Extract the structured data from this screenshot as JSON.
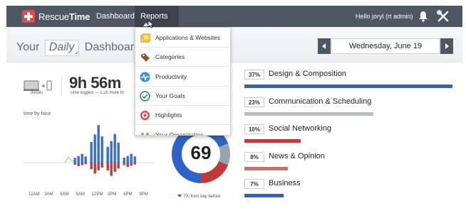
{
  "topbar": {
    "brand_light": "Rescue",
    "brand_bold": "Time",
    "nav_dashboard": "Dashboard",
    "nav_reports": "Reports",
    "greeting": "Hello joryl (rt admin)"
  },
  "header": {
    "title_prefix": "Your",
    "period": "Daily",
    "title_suffix": "Dashboard",
    "date": "Wednesday, June 19"
  },
  "summary": {
    "details_label": "details",
    "time_logged": "9h 56m",
    "time_logged_sub": "Time logged — 1.2h more th"
  },
  "hour_chart": {
    "label": "time by hour",
    "ticks": [
      "12AM",
      "3AM",
      "6AM",
      "9AM",
      "12PM",
      "3PM",
      "6PM",
      "9PM"
    ]
  },
  "chart_data": {
    "type": "bar",
    "title": "time by hour",
    "categories": [
      "12AM",
      "3AM",
      "6AM",
      "9AM",
      "12PM",
      "3PM",
      "6PM",
      "9PM"
    ],
    "series": [
      {
        "values": [
          0,
          0,
          0,
          20,
          85,
          65,
          20,
          0
        ],
        "color": "#3a6fc8"
      },
      {
        "values": [
          0,
          0,
          0,
          8,
          25,
          30,
          10,
          0
        ],
        "color": "#c0393b"
      }
    ]
  },
  "pulse": {
    "score": "69",
    "score_value": 69,
    "delta_text": "7% from day before",
    "colors": {
      "productive": "#2e63c6",
      "neutral": "#9aa3ad",
      "distracting": "#c0393b"
    }
  },
  "categories": [
    {
      "pct": "37%",
      "name": "Design & Composition",
      "fraction": 1.0,
      "color": "#2e63c6"
    },
    {
      "pct": "23%",
      "name": "Communication & Scheduling",
      "fraction": 0.62,
      "color": "#b9bcc0"
    },
    {
      "pct": "10%",
      "name": "Social Networking",
      "fraction": 0.27,
      "color": "#c0393b"
    },
    {
      "pct": "8%",
      "name": "News & Opinion",
      "fraction": 0.21,
      "color": "#d46a6a"
    },
    {
      "pct": "7%",
      "name": "Business",
      "fraction": 0.19,
      "color": "#2e63c6"
    }
  ],
  "reports_menu": {
    "items": [
      {
        "label": "Applications & Websites",
        "icon": "applications-icon"
      },
      {
        "label": "Categories",
        "icon": "tag-icon"
      },
      {
        "label": "Productivity",
        "icon": "pulse-icon"
      },
      {
        "label": "Your Goals",
        "icon": "check-circle-icon"
      },
      {
        "label": "Highlights",
        "icon": "highlights-icon"
      },
      {
        "label": "Your Organization",
        "icon": "organization-icon"
      }
    ]
  }
}
